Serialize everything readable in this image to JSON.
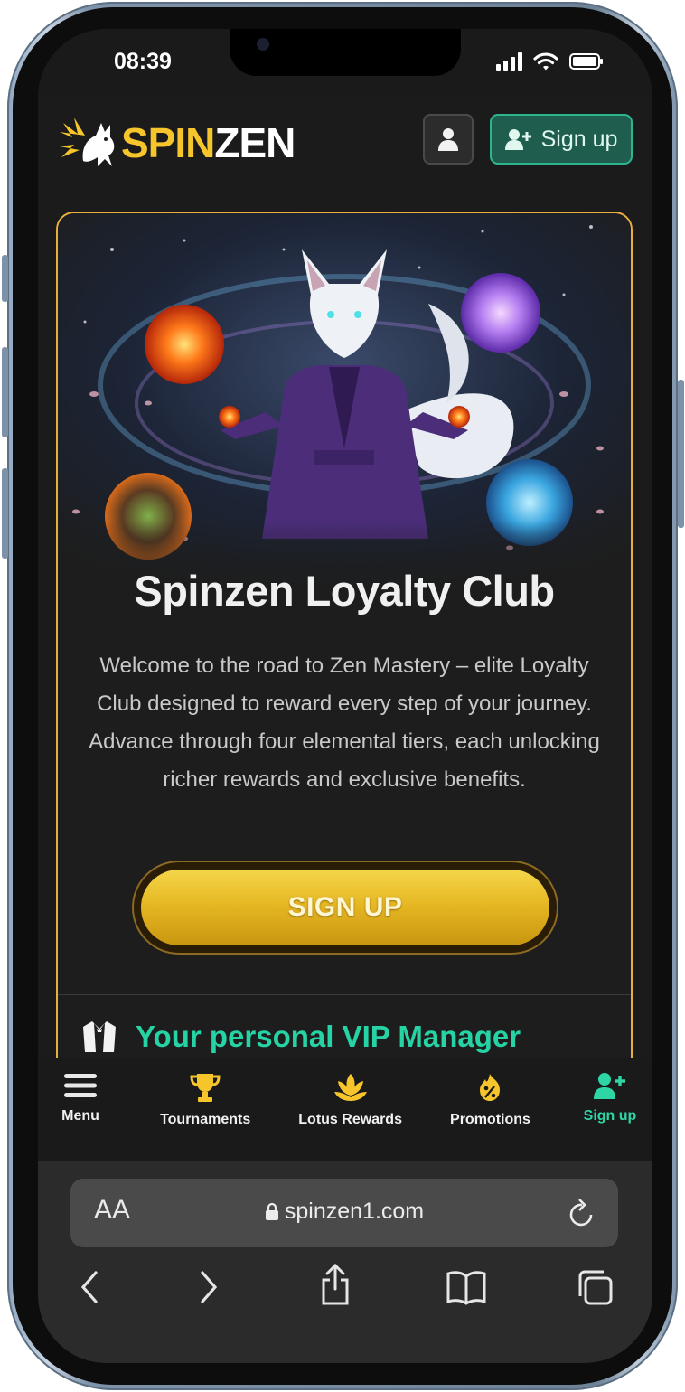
{
  "status_bar": {
    "time": "08:39"
  },
  "header": {
    "logo_part1": "SPIN",
    "logo_part2": "ZEN",
    "signup_label": "Sign up"
  },
  "hero": {
    "title": "Spinzen Loyalty Club",
    "description": "Welcome to the road to Zen Mastery – elite Loyalty Club designed to reward every step of your journey. Advance through four elemental tiers, each unlocking richer rewards and exclusive benefits.",
    "cta_label": "SIGN UP"
  },
  "vip": {
    "title": "Your personal VIP Manager"
  },
  "bottom_nav": {
    "items": [
      {
        "label": "Menu",
        "icon": "menu-icon"
      },
      {
        "label": "Tournaments",
        "icon": "trophy-icon"
      },
      {
        "label": "Lotus Rewards",
        "icon": "lotus-icon"
      },
      {
        "label": "Promotions",
        "icon": "percent-fire-icon"
      },
      {
        "label": "Sign up",
        "icon": "add-user-icon"
      }
    ]
  },
  "browser": {
    "text_size_label": "AA",
    "url": "spinzen1.com"
  },
  "colors": {
    "brand_gold": "#f5c52b",
    "accent_green": "#26d3a5",
    "card_border": "#e9ae3c",
    "background": "#1b1b1b"
  }
}
